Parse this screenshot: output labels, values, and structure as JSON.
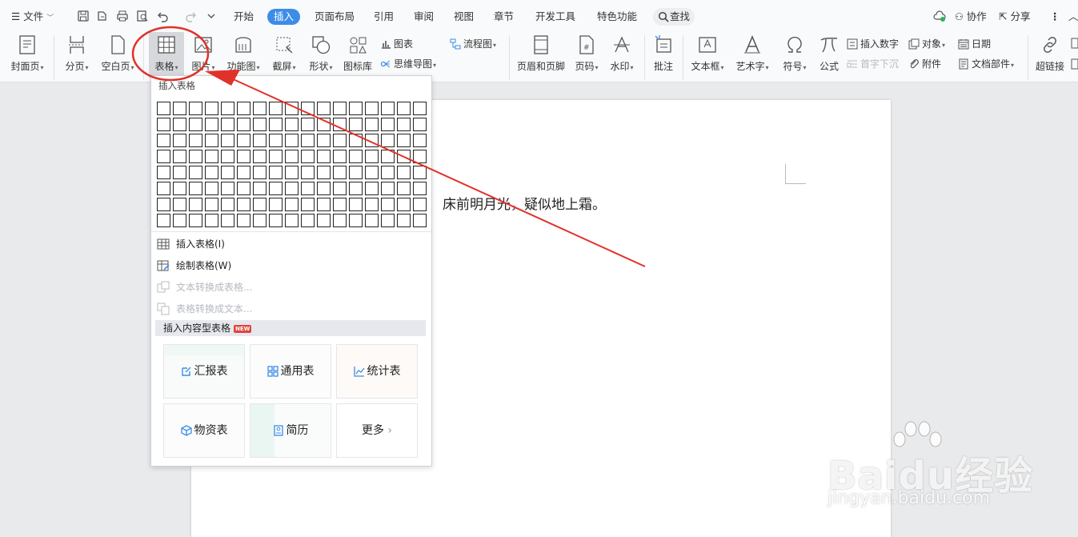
{
  "menubar": {
    "file_label": "文件",
    "tabs": [
      "开始",
      "插入",
      "页面布局",
      "引用",
      "审阅",
      "视图",
      "章节",
      "开发工具",
      "特色功能"
    ],
    "active_tab": "插入",
    "search_label": "查找",
    "collab_label": "协作",
    "share_label": "分享"
  },
  "ribbon": {
    "cover": "封面页",
    "page_break": "分页",
    "blank_page": "空白页",
    "table": "表格",
    "picture": "图片",
    "function_chart": "功能图",
    "screenshot": "截屏",
    "shape": "形状",
    "icon_lib": "图标库",
    "chart": "图表",
    "mindmap": "思维导图",
    "flowchart": "流程图",
    "header_footer": "页眉和页脚",
    "page_number": "页码",
    "watermark": "水印",
    "comment": "批注",
    "textbox": "文本框",
    "wordart": "艺术字",
    "symbol": "符号",
    "formula": "公式",
    "insert_number": "插入数字",
    "drop_cap": "首字下沉",
    "object": "对象",
    "attachment": "附件",
    "date": "日期",
    "doc_parts": "文档部件",
    "hyperlink": "超链接"
  },
  "document": {
    "text": "床前明月光，疑似地上霜。"
  },
  "dropdown": {
    "title": "插入表格",
    "grid_rows": 8,
    "grid_cols": 17,
    "items": [
      {
        "label": "插入表格(I)",
        "enabled": true
      },
      {
        "label": "绘制表格(W)",
        "enabled": true
      },
      {
        "label": "文本转换成表格...",
        "enabled": false
      },
      {
        "label": "表格转换成文本...",
        "enabled": false
      }
    ],
    "content_header": "插入内容型表格",
    "new_badge": "NEW",
    "cards": [
      "汇报表",
      "通用表",
      "统计表",
      "物资表",
      "简历",
      "更多"
    ]
  },
  "watermark": {
    "brand": "Baidu经验",
    "sub": "jingyan.baidu.com"
  },
  "colors": {
    "accent": "#3c8de7",
    "annotation": "#e0322a"
  }
}
